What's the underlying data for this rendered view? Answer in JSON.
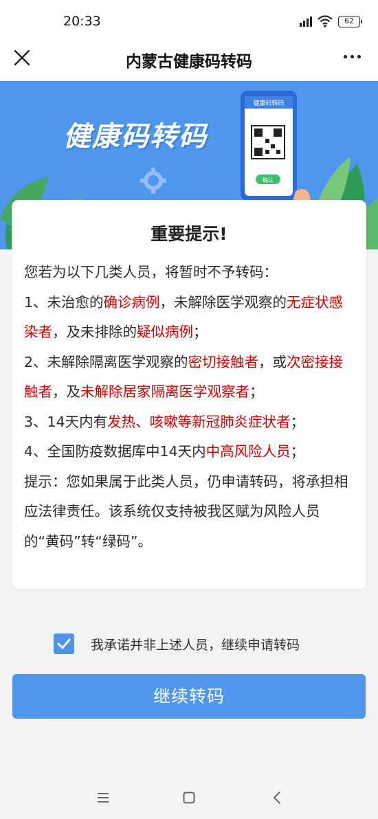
{
  "status_bar": {
    "time": "20:33",
    "battery": "62",
    "icons": [
      "signal-icon",
      "wifi-icon",
      "battery-icon"
    ]
  },
  "nav": {
    "title": "内蒙古健康码转码",
    "close_icon": "close-icon",
    "more_icon": "more-icon"
  },
  "banner": {
    "title": "健康码转码",
    "phone_label": "健康码转码",
    "phone_button": "确认"
  },
  "notice": {
    "title": "重要提示!",
    "intro": "您若为以下几类人员，将暂时不予转码：",
    "item1": {
      "p1": "1、未治愈的",
      "r1": "确诊病例",
      "p2": "，未解除医学观察的",
      "r2": "无症状感染者",
      "p3": "，及未排除的",
      "r3": "疑似病例",
      "p4": "；"
    },
    "item2": {
      "p1": "2、未解除隔离医学观察的",
      "r1": "密切接触者",
      "p2": "，或",
      "r2": "次密接接触者",
      "p3": "，及",
      "r3": "未解除居家隔离医学观察者",
      "p4": "；"
    },
    "item3": {
      "p1": "3、14天内有",
      "r1": "发热、咳嗽等新冠肺炎症状者",
      "p2": "；"
    },
    "item4": {
      "p1": "4、全国防疫数据库中14天内",
      "r1": "中高风险人员",
      "p2": "；"
    },
    "tip": "提示：您如果属于此类人员，仍申请转码，将承担相应法律责任。该系统仅支持被我区赋为风险人员的“黄码”转“绿码”。"
  },
  "agreement": {
    "checked": true,
    "label": "我承诺并非上述人员，继续申请转码"
  },
  "actions": {
    "continue_label": "继续转码"
  },
  "system_nav": {
    "icons": [
      "menu-icon",
      "home-icon",
      "back-icon"
    ]
  },
  "colors": {
    "accent": "#4f97ee",
    "highlight": "#d40000",
    "background": "#f2f3f5"
  }
}
